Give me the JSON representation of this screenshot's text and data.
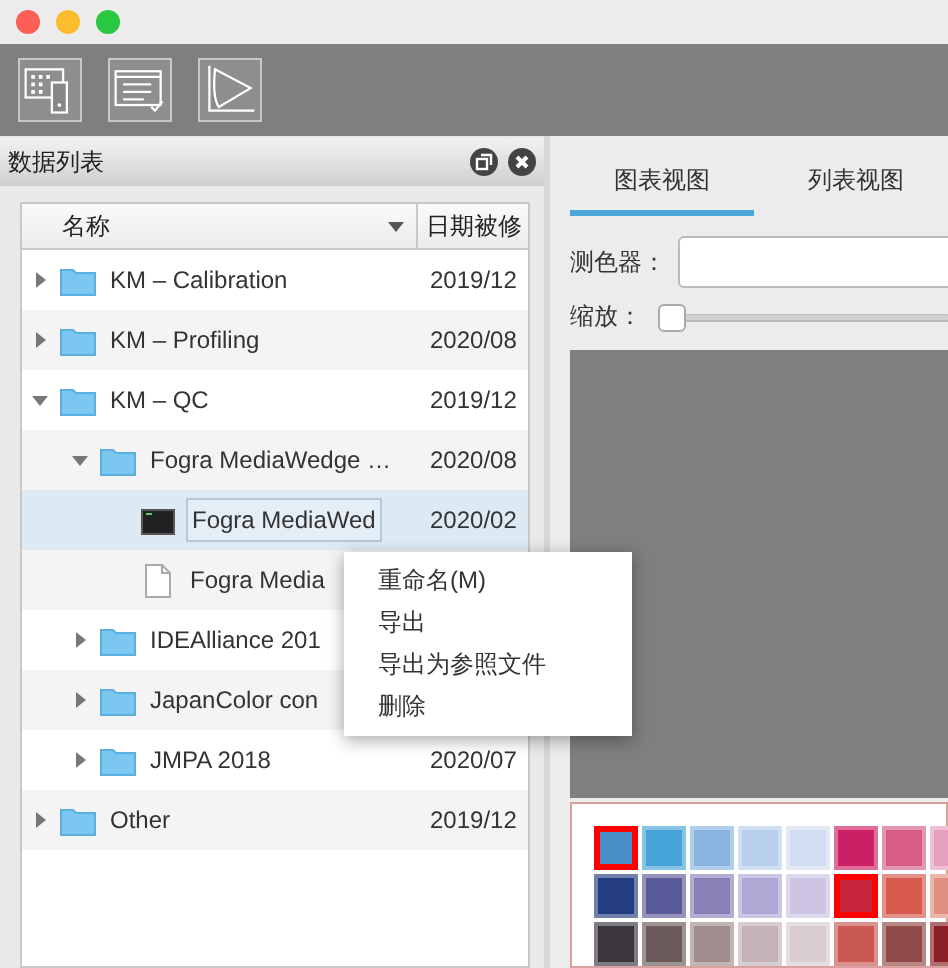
{
  "panel": {
    "title": "数据列表"
  },
  "tree_columns": [
    {
      "label": "名称",
      "sorted": true
    },
    {
      "label": "日期被修"
    }
  ],
  "tree": [
    {
      "kind": "folder",
      "name": "KM – Calibration",
      "date": "2019/12",
      "expanded": false,
      "selected": false
    },
    {
      "kind": "folder",
      "name": "KM – Profiling",
      "date": "2020/08",
      "expanded": false,
      "selected": false
    },
    {
      "kind": "folder",
      "name": "KM – QC",
      "date": "2019/12",
      "expanded": true,
      "selected": false,
      "children": [
        {
          "kind": "folder",
          "name": "Fogra MediaWedge …",
          "date": "2020/08",
          "expanded": true,
          "selected": false,
          "children": [
            {
              "kind": "measurement",
              "name": "Fogra MediaWed",
              "date": "2020/02",
              "selected": true
            },
            {
              "kind": "document",
              "name": "Fogra Media",
              "selected": false
            }
          ]
        },
        {
          "kind": "folder",
          "name": "IDEAlliance 201",
          "expanded": false,
          "selected": false
        },
        {
          "kind": "folder",
          "name": "JapanColor con",
          "expanded": false,
          "selected": false
        },
        {
          "kind": "folder",
          "name": "JMPA 2018",
          "date": "2020/07",
          "expanded": false,
          "selected": false
        }
      ]
    },
    {
      "kind": "folder",
      "name": "Other",
      "date": "2019/12",
      "expanded": false,
      "selected": false
    }
  ],
  "context_menu": [
    "重命名(M)",
    "导出",
    "导出为参照文件",
    "删除"
  ],
  "tabs": [
    {
      "label": "图表视图",
      "selected": true
    },
    {
      "label": "列表视图",
      "selected": false
    }
  ],
  "instrument": {
    "label": "测色器："
  },
  "zoom": {
    "label": "缩放：",
    "level": 0
  },
  "patches": [
    [
      {
        "color": "#4a90c8",
        "selected": true
      },
      {
        "color": "#45a5d8",
        "selected": false
      },
      {
        "color": "#8ab4e0",
        "selected": false
      },
      {
        "color": "#b8cfec",
        "selected": false
      },
      {
        "color": "#d3ddf2",
        "selected": false
      },
      {
        "color": "#cc2064",
        "selected": false
      },
      {
        "color": "#d85e8a",
        "selected": false
      },
      {
        "color": "#e8a0c0",
        "selected": false
      }
    ],
    [
      {
        "color": "#243c80",
        "selected": false
      },
      {
        "color": "#5a5a9a",
        "selected": false
      },
      {
        "color": "#8a80b8",
        "selected": false
      },
      {
        "color": "#b0a8d4",
        "selected": false
      },
      {
        "color": "#ccc4e2",
        "selected": false
      },
      {
        "color": "#c8243c",
        "selected": true
      },
      {
        "color": "#d85a4c",
        "selected": false
      },
      {
        "color": "#e09080",
        "selected": false
      }
    ],
    [
      {
        "color": "#3a363c",
        "selected": false
      },
      {
        "color": "#6a5a5a",
        "selected": false
      },
      {
        "color": "#a08c8c",
        "selected": false
      },
      {
        "color": "#c4b4b8",
        "selected": false
      },
      {
        "color": "#d8ccd0",
        "selected": false
      },
      {
        "color": "#c85a52",
        "selected": false
      },
      {
        "color": "#904a48",
        "selected": false
      },
      {
        "color": "#8a1e24",
        "selected": false
      }
    ]
  ]
}
